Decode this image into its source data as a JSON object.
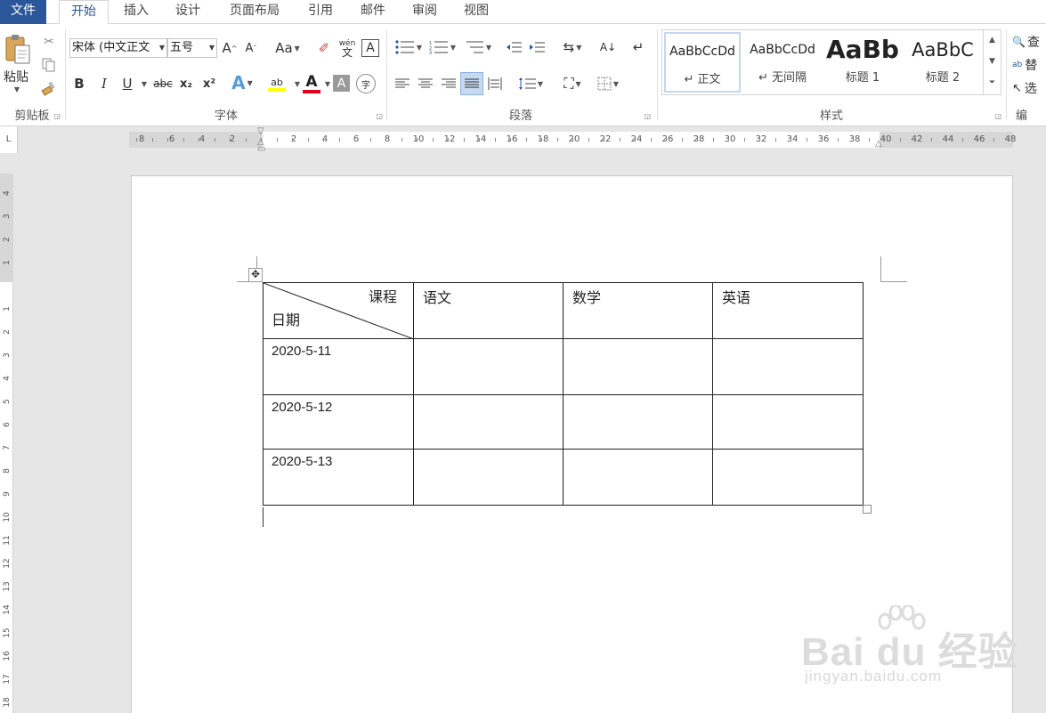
{
  "tabs": [
    {
      "label": "文件"
    },
    {
      "label": "开始"
    },
    {
      "label": "插入"
    },
    {
      "label": "设计"
    },
    {
      "label": "页面布局"
    },
    {
      "label": "引用"
    },
    {
      "label": "邮件"
    },
    {
      "label": "审阅"
    },
    {
      "label": "视图"
    }
  ],
  "ribbon": {
    "clipboard": {
      "paste_label": "粘贴",
      "group_label": "剪贴板"
    },
    "font": {
      "font_name": "宋体 (中文正文",
      "font_size": "五号",
      "grow_label": "A",
      "shrink_label": "A",
      "case_label": "Aa",
      "phonetic_top": "wén",
      "phonetic_bottom": "文",
      "border_label": "A",
      "bold": "B",
      "italic": "I",
      "underline": "U",
      "strike": "abc",
      "sub": "x₂",
      "sup": "x²",
      "effects": "A",
      "highlight": "ab",
      "color": "A",
      "shading": "A",
      "enclose": "字",
      "group_label": "字体"
    },
    "paragraph": {
      "group_label": "段落"
    },
    "styles": {
      "items": [
        {
          "preview": "AaBbCcDd",
          "name": "↵ 正文"
        },
        {
          "preview": "AaBbCcDd",
          "name": "↵ 无间隔"
        },
        {
          "preview": "AaBb",
          "name": "标题 1"
        },
        {
          "preview": "AaBbC",
          "name": "标题 2"
        }
      ],
      "group_label": "样式"
    },
    "editing": {
      "find": "查",
      "replace": "替",
      "select": "选",
      "group_label": "编"
    }
  },
  "ruler": {
    "corner": "L",
    "numbers": [
      "8",
      "6",
      "4",
      "2",
      "2",
      "4",
      "6",
      "8",
      "10",
      "12",
      "14",
      "16",
      "18",
      "20",
      "22",
      "24",
      "26",
      "28",
      "30",
      "32",
      "34",
      "36",
      "38",
      "40",
      "42",
      "44",
      "46",
      "48"
    ],
    "vnumbers": [
      "4",
      "3",
      "2",
      "1",
      "1",
      "2",
      "3",
      "4",
      "5",
      "6",
      "7",
      "8",
      "9",
      "10",
      "11",
      "12",
      "13",
      "14",
      "15",
      "16",
      "17",
      "18"
    ]
  },
  "table": {
    "header_top": "课程",
    "header_bottom": "日期",
    "columns": [
      "语文",
      "数学",
      "英语"
    ],
    "rows": [
      {
        "date": "2020-5-11",
        "cells": [
          "",
          "",
          ""
        ]
      },
      {
        "date": "2020-5-12",
        "cells": [
          "",
          "",
          ""
        ]
      },
      {
        "date": "2020-5-13",
        "cells": [
          "",
          "",
          ""
        ]
      }
    ]
  },
  "watermark": {
    "main": "Bai du 经验",
    "sub": "jingyan.baidu.com"
  }
}
